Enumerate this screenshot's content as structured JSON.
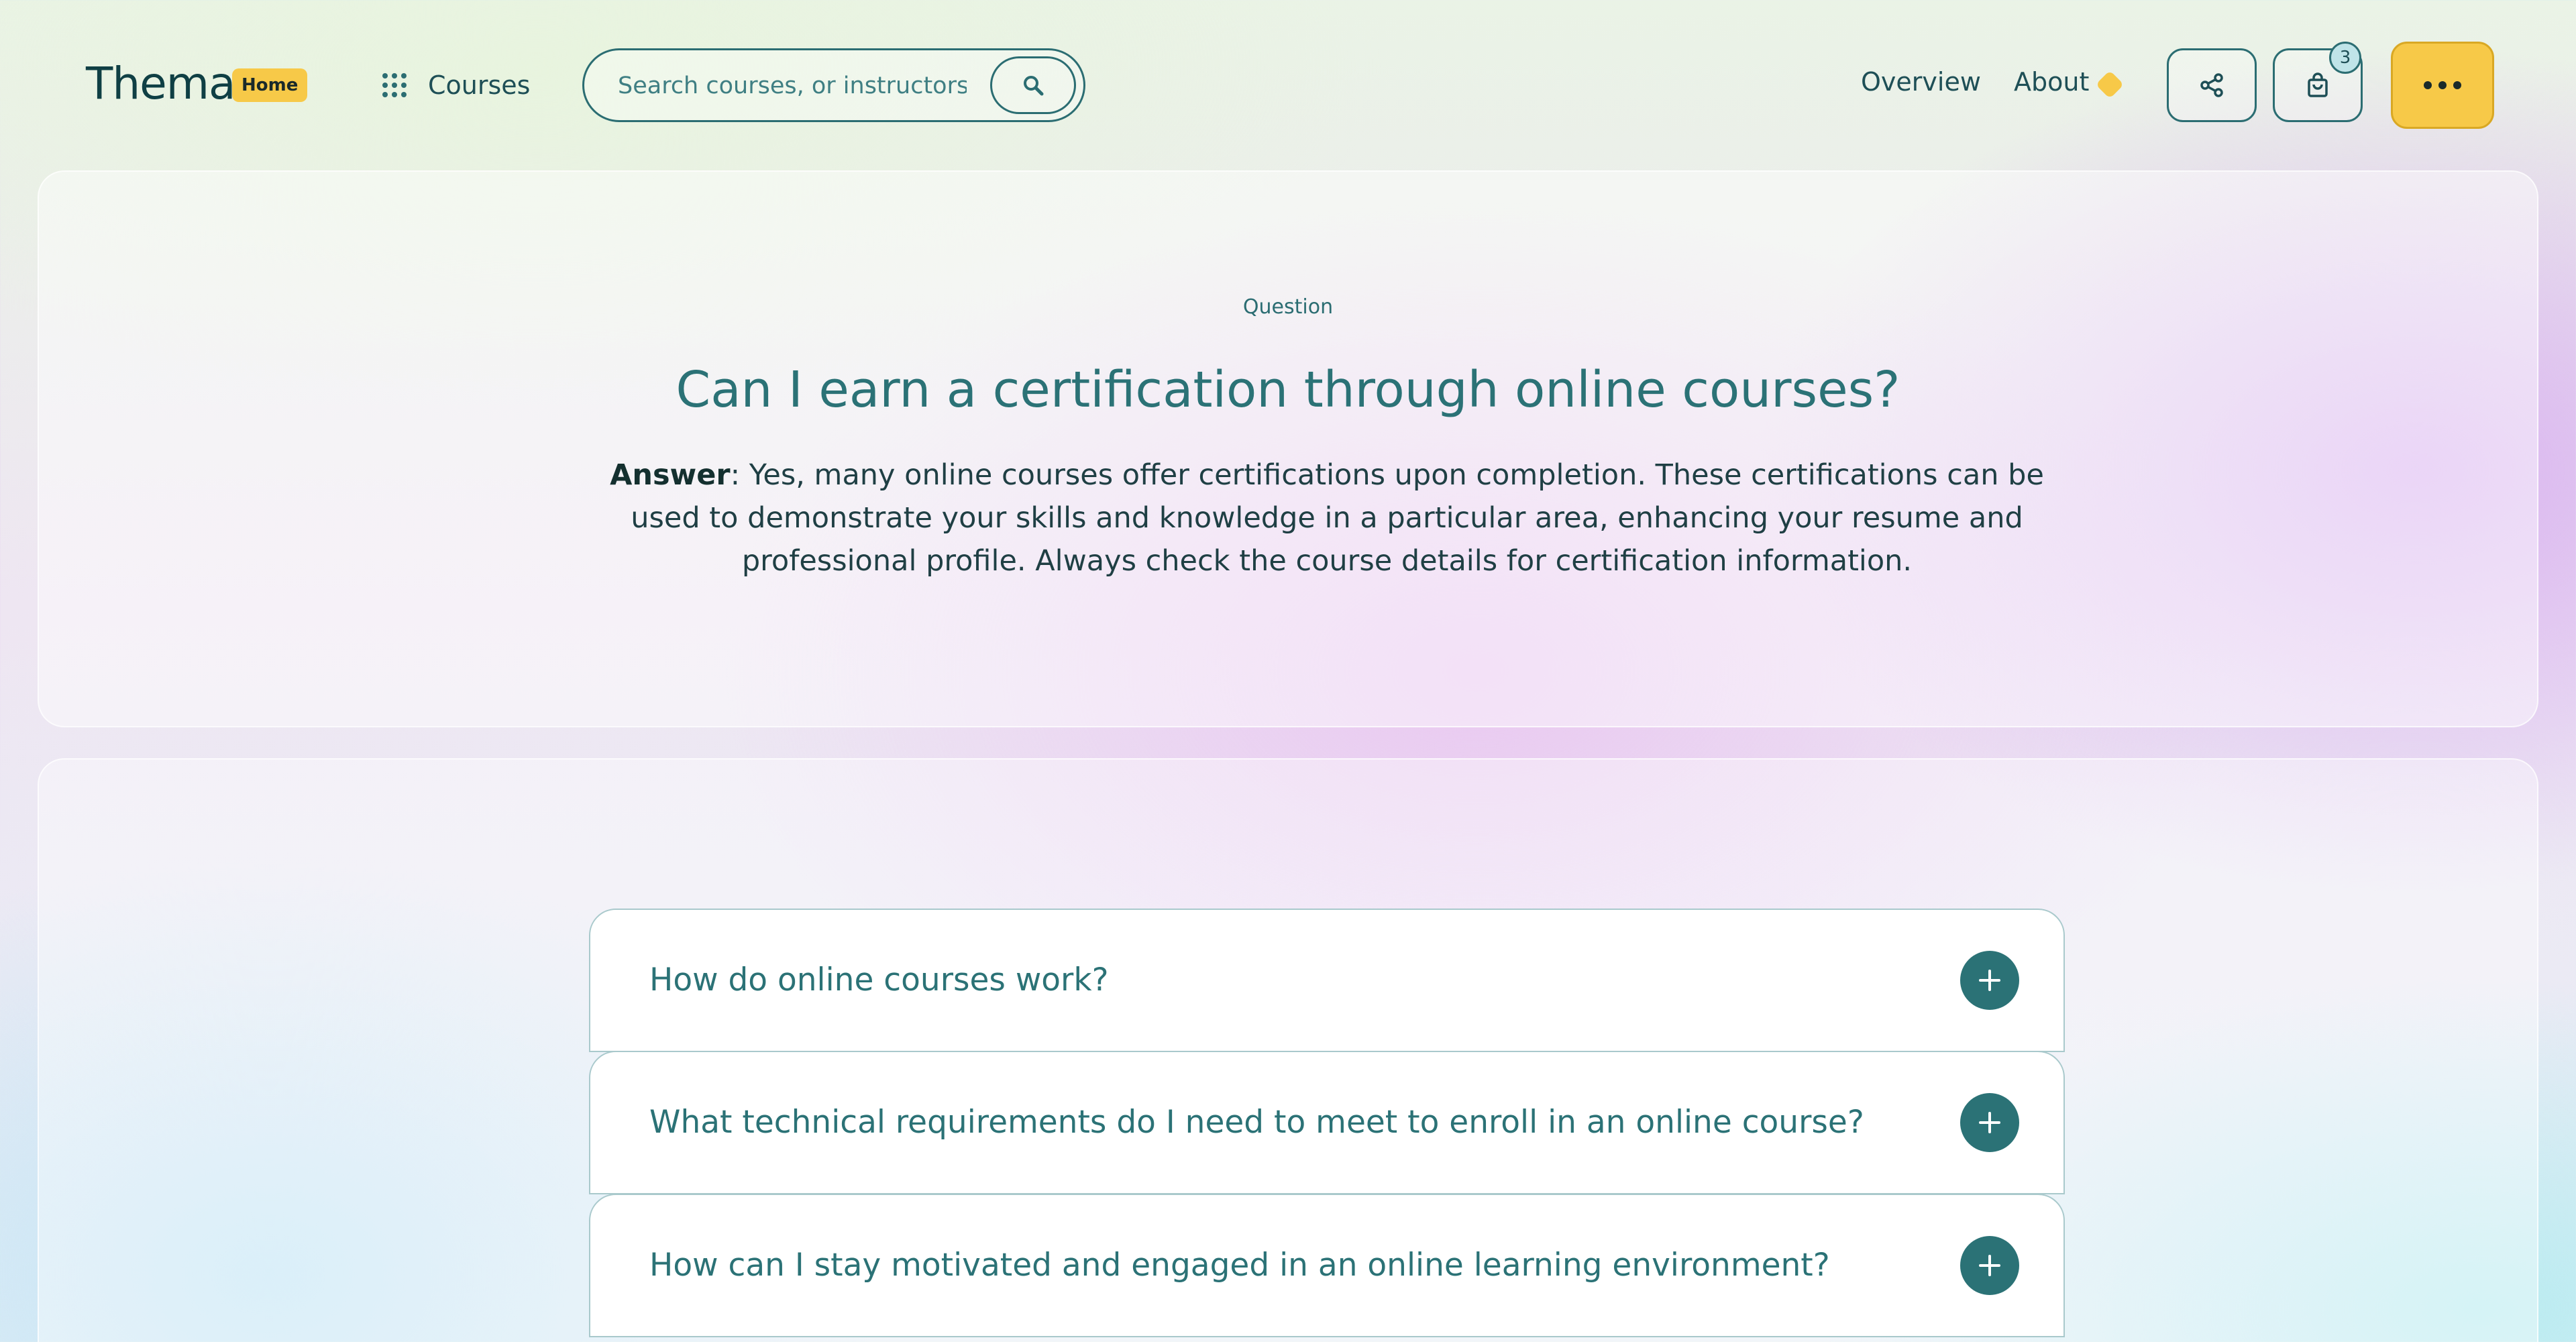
{
  "header": {
    "logo": "Thema",
    "home_badge": "Home",
    "courses_label": "Courses",
    "search_placeholder": "Search courses, or instructors",
    "nav": {
      "overview": "Overview",
      "about": "About"
    },
    "cart_count": "3"
  },
  "answer_card": {
    "eyebrow": "Question",
    "title": "Can I earn a certification through online courses?",
    "answer_label": "Answer",
    "answer_text": ": Yes, many online courses offer certifications upon completion. These certifications can be used to demonstrate your skills and knowledge in a particular area, enhancing your resume and professional profile. Always check the course details for certification information."
  },
  "faq": {
    "items": [
      {
        "question": "How do online courses work?"
      },
      {
        "question": "What technical requirements do I need to meet to enroll in an online course?"
      },
      {
        "question": "How can I stay motivated and engaged in an online learning environment?"
      }
    ]
  },
  "colors": {
    "primary": "#2b7276",
    "accent": "#f7c948",
    "text_dark": "#0f3f44"
  },
  "icons": {
    "courses": "grid-icon",
    "search": "search-icon",
    "about": "diamond-icon",
    "share": "share-icon",
    "cart": "shopping-bag-icon",
    "more": "more-dots-icon",
    "faq_toggle": "plus-icon"
  }
}
